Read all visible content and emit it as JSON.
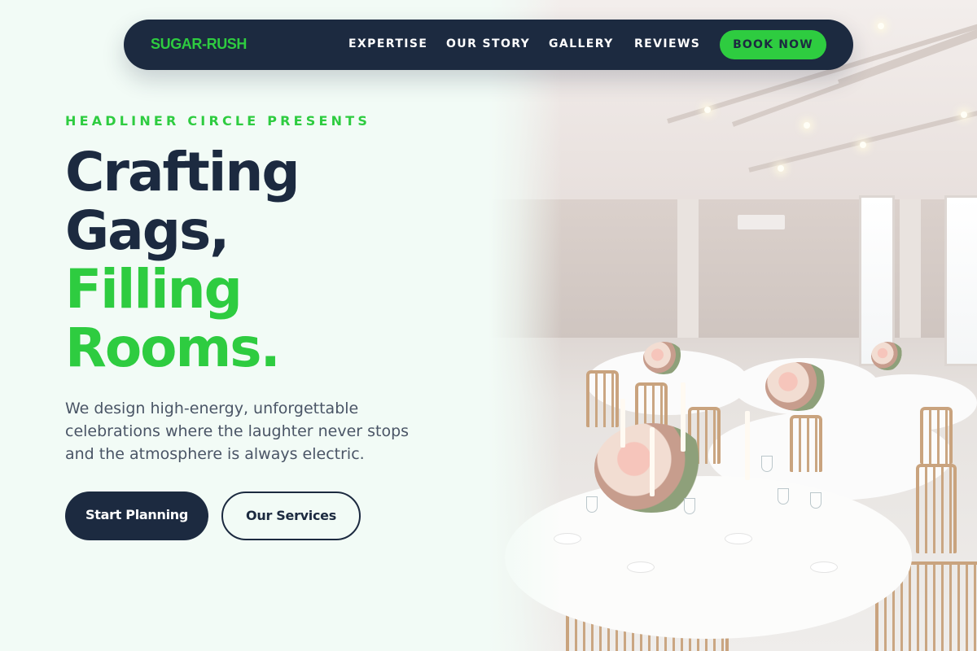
{
  "brand": {
    "name": "SUGAR-RUSH"
  },
  "nav": {
    "links": [
      "EXPERTISE",
      "OUR STORY",
      "GALLERY",
      "REVIEWS"
    ],
    "cta": "BOOK NOW"
  },
  "hero": {
    "eyebrow": "HEADLINER CIRCLE PRESENTS",
    "headline": {
      "line1": "Crafting",
      "line2": "Gags,",
      "line3": "Filling",
      "line4": "Rooms."
    },
    "description": "We design high-energy, unforgettable celebrations where the laughter never stops and the atmosphere is always electric.",
    "primary_button": "Start Planning",
    "secondary_button": "Our Services",
    "image": "banquet-hall-photo"
  },
  "colors": {
    "accent": "#2ecc40",
    "navy": "#1c2a40",
    "background": "#f2fbf6",
    "body_text": "#4a5566"
  }
}
